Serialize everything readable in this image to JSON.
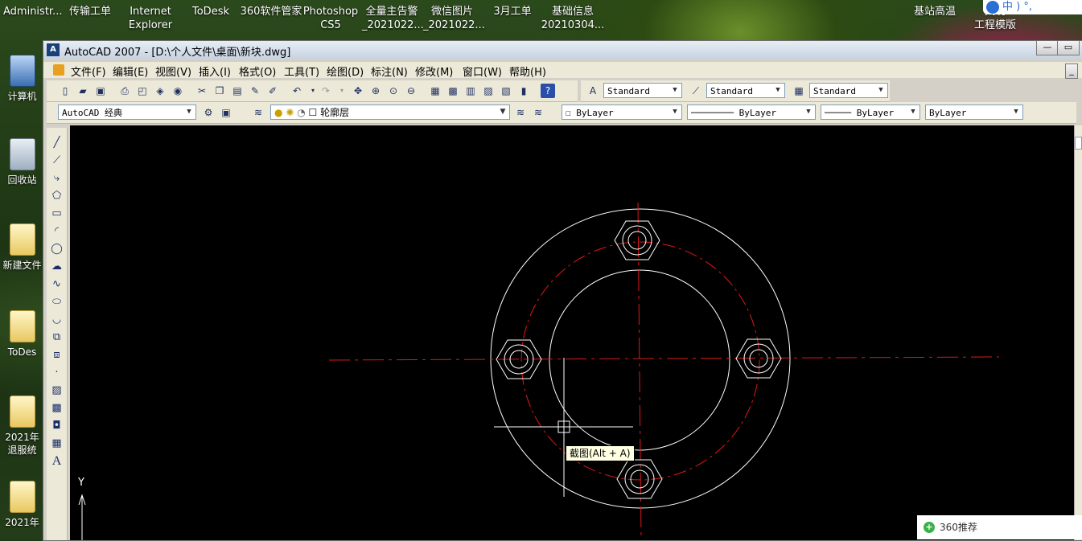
{
  "desktop": {
    "top_icons": [
      {
        "label": "Administr..."
      },
      {
        "label": "传输工单"
      },
      {
        "label": "Internet\nExplorer"
      },
      {
        "label": "ToDesk"
      },
      {
        "label": "360软件管家"
      },
      {
        "label": "Photoshop\nCS5"
      },
      {
        "label": "全量主告警\n_2021022..."
      },
      {
        "label": "微信图片\n_2021022..."
      },
      {
        "label": "3月工单"
      },
      {
        "label": "基础信息\n20210304..."
      },
      {
        "label": "基站高温"
      },
      {
        "label": "大明\n工程模版"
      }
    ],
    "left_icons": [
      {
        "label": "计算机"
      },
      {
        "label": "回收站"
      },
      {
        "label": "新建文件"
      },
      {
        "label": "ToDes"
      },
      {
        "label": "2021年\n退服统"
      },
      {
        "label": "2021年\n"
      }
    ],
    "ime": {
      "label": "中 ) °,"
    },
    "notification": {
      "label": "360推荐"
    }
  },
  "window": {
    "title": "AutoCAD 2007 - [D:\\个人文件\\桌面\\新块.dwg]",
    "app_icon": "A",
    "menu": [
      "文件(F)",
      "编辑(E)",
      "视图(V)",
      "插入(I)",
      "格式(O)",
      "工具(T)",
      "绘图(D)",
      "标注(N)",
      "修改(M)",
      "窗口(W)",
      "帮助(H)"
    ],
    "styles": {
      "text_style": "Standard",
      "dim_style": "Standard",
      "table_style": "Standard"
    },
    "workspace": "AutoCAD 经典",
    "layer": "轮廓层",
    "properties": {
      "color": "ByLayer",
      "linetype": "ByLayer",
      "lineweight": "ByLayer",
      "plotstyle": "ByLayer"
    },
    "draw_tool_text": "A",
    "ucs_y_label": "Y",
    "tooltip": "截图(Alt + A)"
  }
}
